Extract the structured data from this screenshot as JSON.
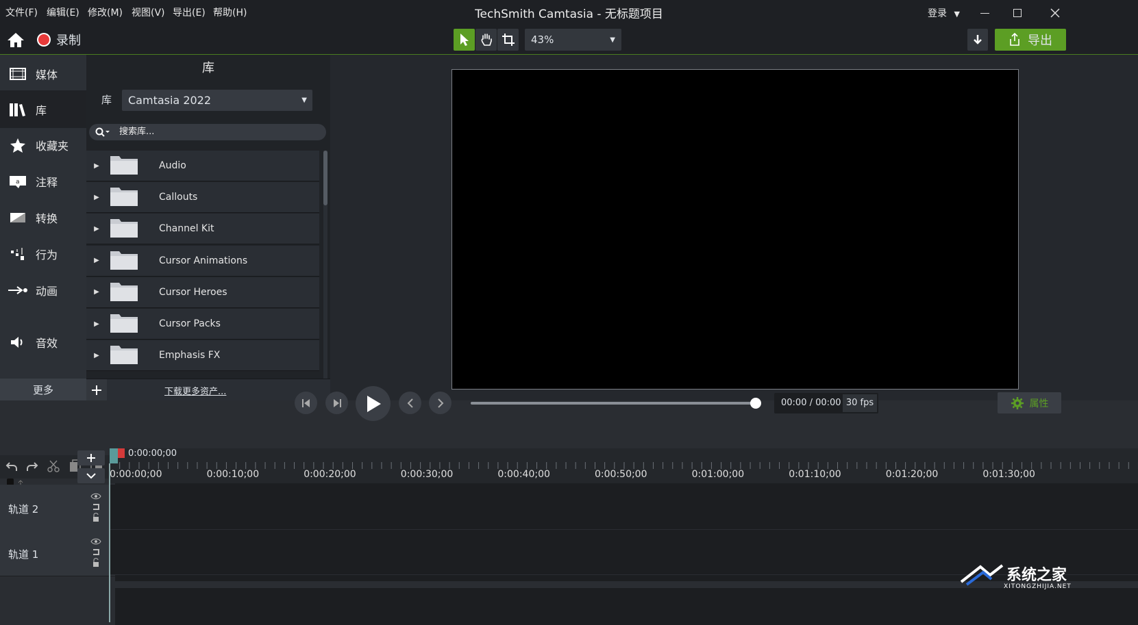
{
  "window": {
    "title": "TechSmith Camtasia - 无标题项目",
    "login": "登录"
  },
  "menu": [
    "文件(F)",
    "编辑(E)",
    "修改(M)",
    "视图(V)",
    "导出(E)",
    "帮助(H)"
  ],
  "toolbar": {
    "record_label": "录制",
    "zoom": "43%",
    "export_label": "导出"
  },
  "nav": {
    "items": [
      "媒体",
      "库",
      "收藏夹",
      "注释",
      "转换",
      "行为",
      "动画",
      "音效"
    ],
    "active": "库",
    "more": "更多"
  },
  "library": {
    "header": "库",
    "select_label": "库",
    "selected": "Camtasia 2022",
    "search_placeholder": "搜索库...",
    "folders": [
      "Audio",
      "Callouts",
      "Channel Kit",
      "Cursor Animations",
      "Cursor Heroes",
      "Cursor Packs",
      "Emphasis FX"
    ],
    "download_more": "下载更多资产..."
  },
  "playback": {
    "time": "00:00 / 00:00",
    "fps": "30 fps",
    "properties": "属性",
    "progress": 1.0
  },
  "timeline": {
    "playhead_time": "0:00:00;00",
    "zoom_level": 0.42,
    "ruler": [
      "0:00:00;00",
      "0:00:10;00",
      "0:00:20;00",
      "0:00:30;00",
      "0:00:40;00",
      "0:00:50;00",
      "0:01:00;00",
      "0:01:10;00",
      "0:01:20;00",
      "0:01:30;00"
    ],
    "tracks": [
      "轨道 2",
      "轨道 1"
    ]
  },
  "watermark": {
    "text": "系统之家",
    "url_text": "XITONGZHIJIA.NET"
  },
  "colors": {
    "accent_green": "#5c9e24",
    "record_red": "#e83a3a"
  }
}
